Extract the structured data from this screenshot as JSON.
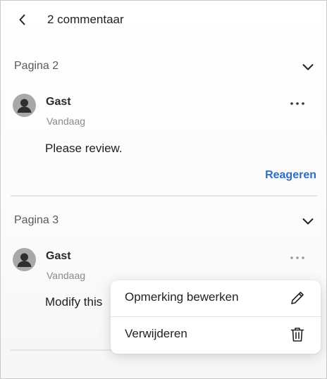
{
  "header": {
    "title": "2 commentaar"
  },
  "sections": [
    {
      "label": "Pagina 2",
      "comment": {
        "author": "Gast",
        "date": "Vandaag",
        "text": "Please review.",
        "reply_label": "Reageren"
      }
    },
    {
      "label": "Pagina 3",
      "comment": {
        "author": "Gast",
        "date": "Vandaag",
        "text": "Modify this"
      }
    }
  ],
  "context_menu": {
    "items": [
      {
        "label": "Opmerking bewerken",
        "icon": "pencil-icon"
      },
      {
        "label": "Verwijderen",
        "icon": "trash-icon"
      }
    ]
  },
  "colors": {
    "accent": "#2f6dc4",
    "avatar": "#a8a8a8"
  }
}
